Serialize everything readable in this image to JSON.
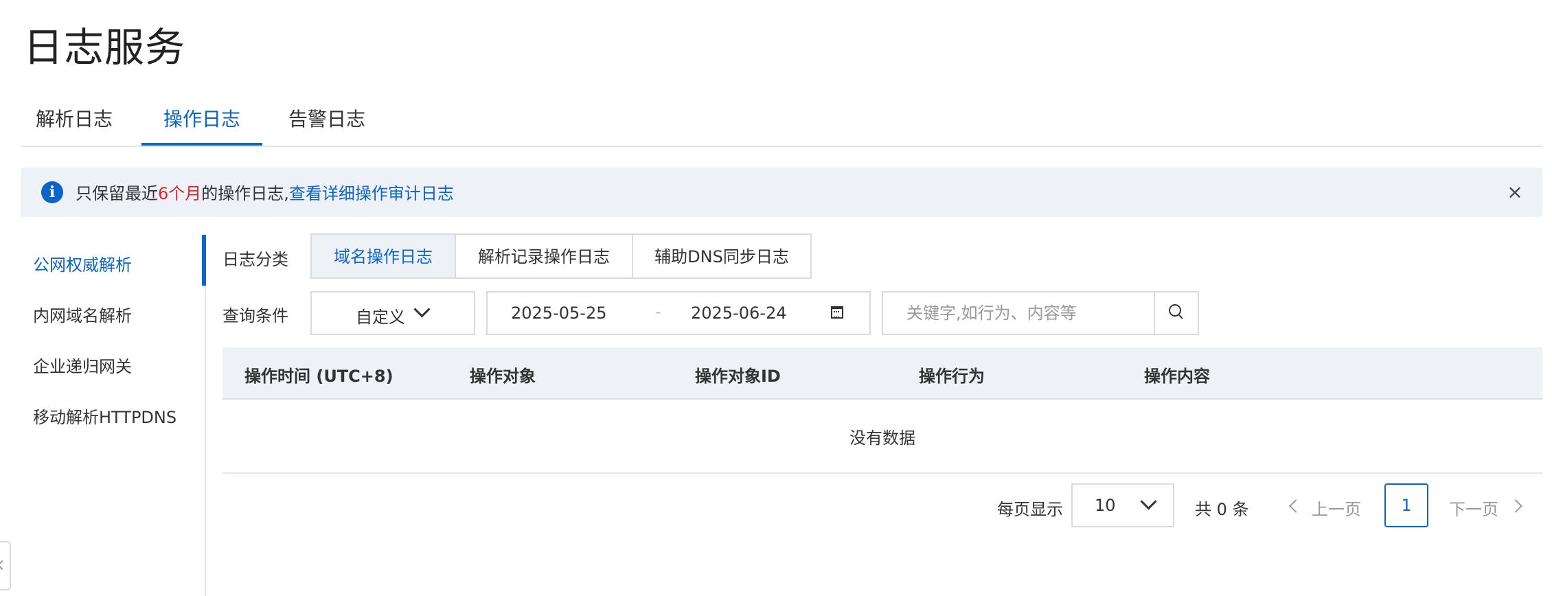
{
  "page_title": "日志服务",
  "tabs": [
    {
      "label": "解析日志",
      "active": false
    },
    {
      "label": "操作日志",
      "active": true
    },
    {
      "label": "告警日志",
      "active": false
    }
  ],
  "notice": {
    "prefix": "只保留最近",
    "highlight": "6个月",
    "suffix": "的操作日志,",
    "link": "查看详细操作审计日志",
    "highlight_color": "#d9272e",
    "link_color": "#0b64c9"
  },
  "sidebar": {
    "items": [
      {
        "label": "公网权威解析",
        "active": true
      },
      {
        "label": "内网域名解析",
        "active": false
      },
      {
        "label": "企业递归网关",
        "active": false
      },
      {
        "label": "移动解析HTTPDNS",
        "active": false
      }
    ]
  },
  "filters": {
    "category_label": "日志分类",
    "categories": [
      {
        "label": "域名操作日志",
        "active": true
      },
      {
        "label": "解析记录操作日志",
        "active": false
      },
      {
        "label": "辅助DNS同步日志",
        "active": false
      }
    ],
    "query_label": "查询条件",
    "range_select": "自定义",
    "date_start": "2025-05-25",
    "date_separator": "-",
    "date_end": "2025-06-24",
    "search_placeholder": "关键字,如行为、内容等"
  },
  "table": {
    "columns": [
      "操作时间 (UTC+8)",
      "操作对象",
      "操作对象ID",
      "操作行为",
      "操作内容"
    ],
    "empty_text": "没有数据"
  },
  "pagination": {
    "page_size_label": "每页显示",
    "page_size": "10",
    "total_text": "共 0 条",
    "prev": "上一页",
    "current_page": "1",
    "next": "下一页"
  },
  "colors": {
    "accent": "#0b64c9",
    "banner_bg": "#eef2f7"
  }
}
